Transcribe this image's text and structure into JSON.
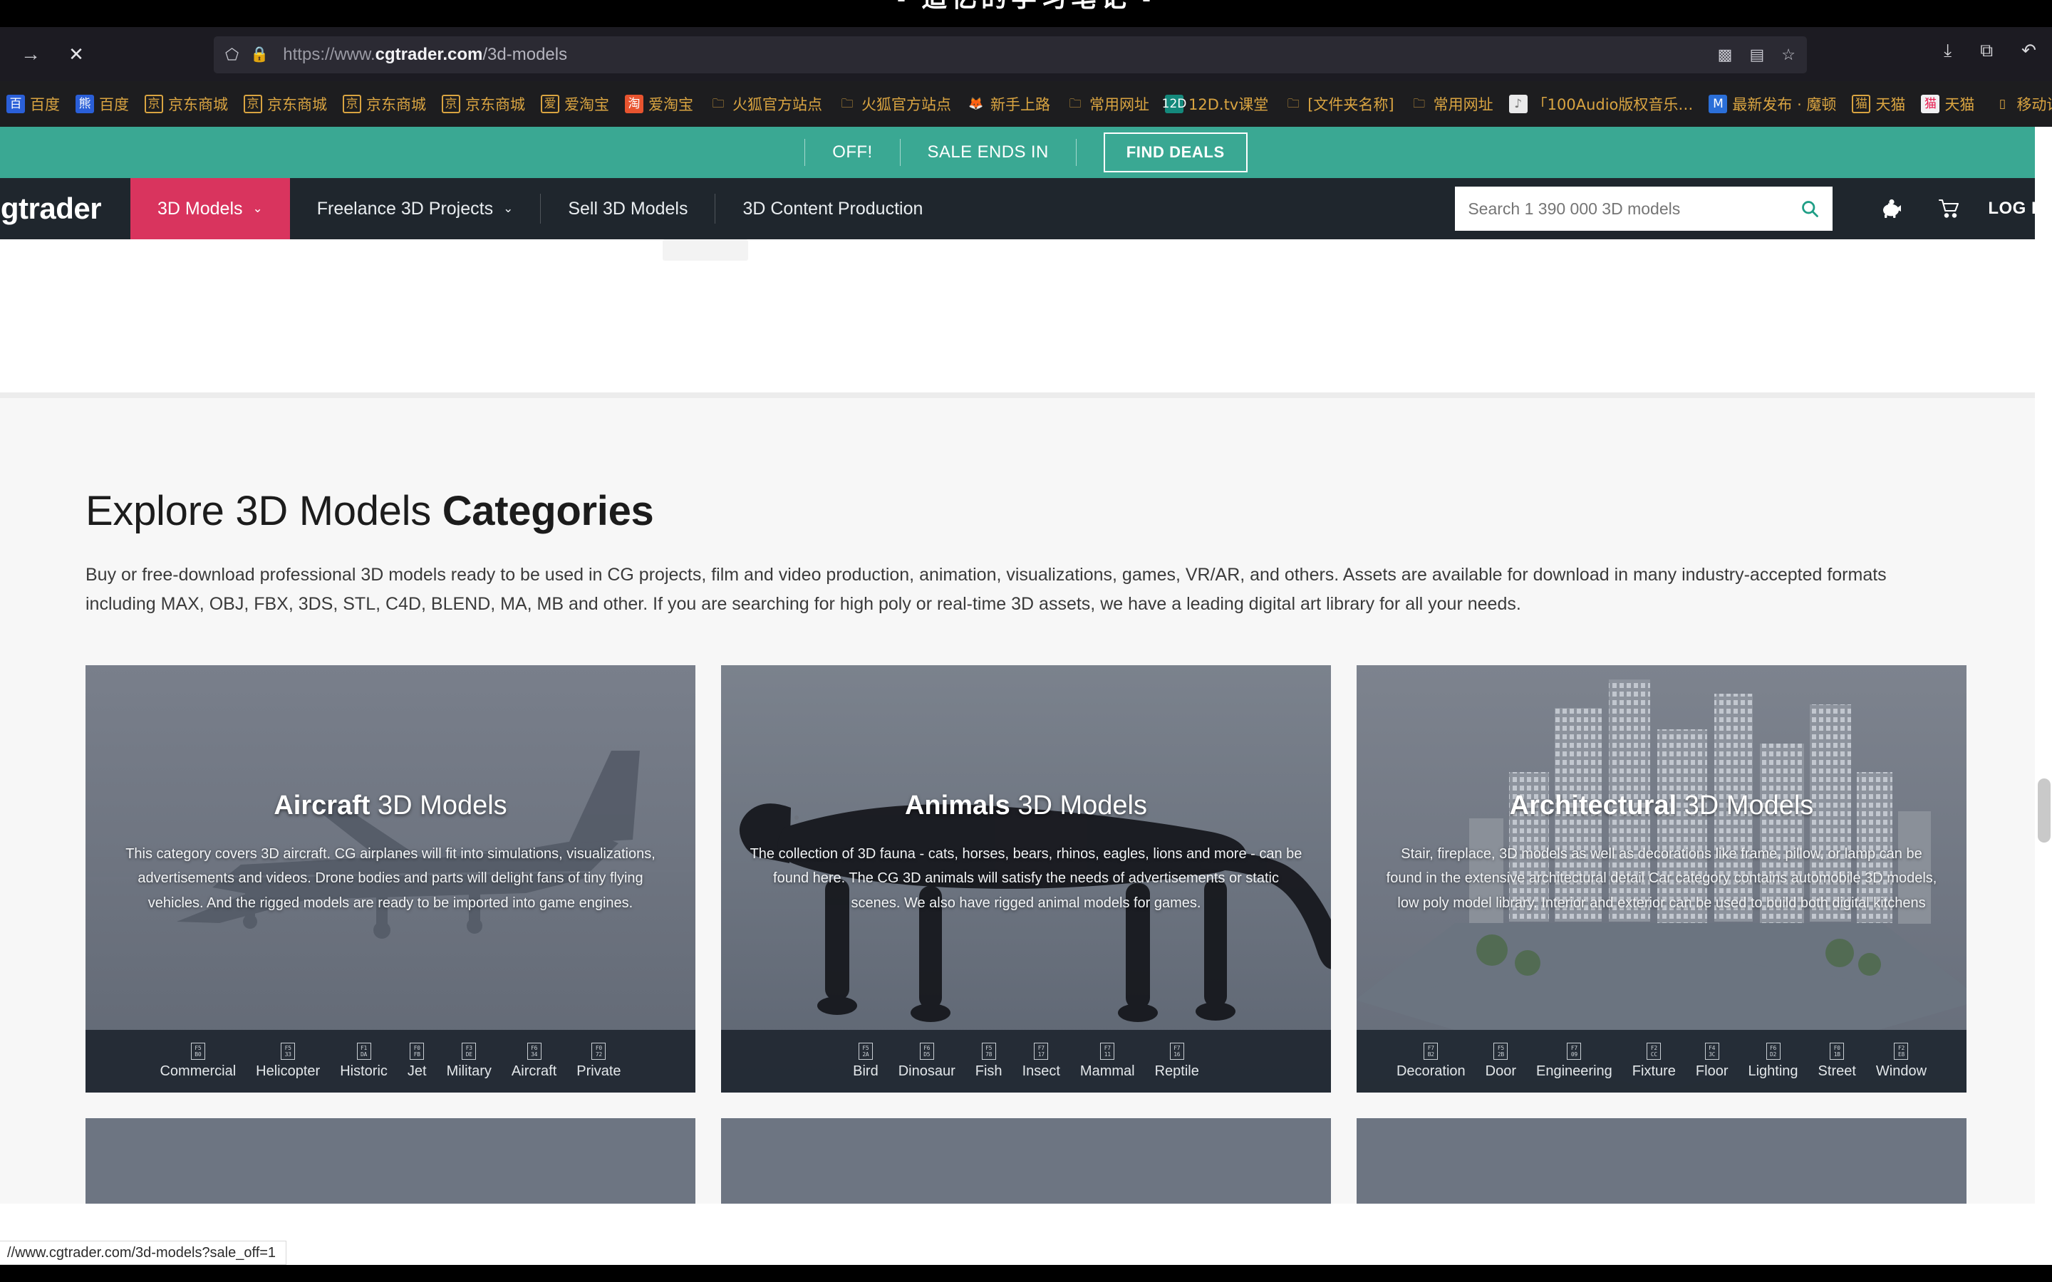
{
  "desktop": {
    "title": "- 追忆的学习笔记 -"
  },
  "browser": {
    "url_scheme": "https://www.",
    "url_host": "cgtrader.com",
    "url_path": "/3d-models",
    "icons": {
      "forward": "forward-arrow-icon",
      "stop": "stop-icon",
      "shield": "shield-icon",
      "lock": "lock-icon",
      "reader": "reader-view-icon",
      "bookmark": "bookmark-star-icon",
      "extension": "extension-icon",
      "download": "download-icon",
      "account": "account-icon",
      "overflow": "overflow-menu-icon"
    },
    "bookmarks": [
      {
        "label": "百度",
        "favicon": "fv-baidu",
        "glyph": "百"
      },
      {
        "label": "百度",
        "favicon": "fv-baidu",
        "glyph": "熊"
      },
      {
        "label": "京东商城",
        "favicon": "fv-jd",
        "glyph": "京"
      },
      {
        "label": "京东商城",
        "favicon": "fv-jd",
        "glyph": "京"
      },
      {
        "label": "京东商城",
        "favicon": "fv-jd",
        "glyph": "京"
      },
      {
        "label": "京东商城",
        "favicon": "fv-jd",
        "glyph": "京"
      },
      {
        "label": "爱淘宝",
        "favicon": "fv-jd",
        "glyph": "爱"
      },
      {
        "label": "爱淘宝",
        "favicon": "fv-tao",
        "glyph": "淘"
      },
      {
        "label": "火狐官方站点",
        "favicon": "fv-folder",
        "glyph": "🗀"
      },
      {
        "label": "火狐官方站点",
        "favicon": "fv-folder",
        "glyph": "🗀"
      },
      {
        "label": "新手上路",
        "favicon": "fv-fox",
        "glyph": "🦊"
      },
      {
        "label": "常用网址",
        "favicon": "fv-folder",
        "glyph": "🗀"
      },
      {
        "label": "12D.tv课堂",
        "favicon": "fv-12d",
        "glyph": "12D"
      },
      {
        "label": "[文件夹名称]",
        "favicon": "fv-folder",
        "glyph": "🗀"
      },
      {
        "label": "常用网址",
        "favicon": "fv-folder",
        "glyph": "🗀"
      },
      {
        "label": "「100Audio版权音乐…",
        "favicon": "fv-img",
        "glyph": "♪"
      },
      {
        "label": "最新发布 · 魔顿",
        "favicon": "fv-blue",
        "glyph": "M"
      },
      {
        "label": "天猫",
        "favicon": "fv-jd",
        "glyph": "猫"
      },
      {
        "label": "天猫",
        "favicon": "fv-tmall",
        "glyph": "猫"
      }
    ],
    "bookmarks_right": {
      "label": "移动设备上的…",
      "favicon": "fv-mobile",
      "glyph": "▯"
    },
    "status_tip": "//www.cgtrader.com/3d-models?sale_off=1"
  },
  "promo": {
    "item1": "OFF!",
    "item2": "SALE ENDS IN",
    "button": "FIND DEALS",
    "bg_color": "#3aa893"
  },
  "nav": {
    "logo": "cgtrader",
    "items": [
      {
        "label": "3D Models",
        "caret": "⌄",
        "active": true
      },
      {
        "label": "Freelance 3D Projects",
        "caret": "⌄",
        "active": false
      },
      {
        "label": "Sell 3D Models",
        "caret": "",
        "active": false
      },
      {
        "label": "3D Content Production",
        "caret": "",
        "active": false
      }
    ],
    "search_placeholder": "Search 1 390 000 3D models",
    "search_value": "",
    "login": "LOG IN",
    "accent_color": "#d9345e",
    "bg_color": "#1f262d"
  },
  "main": {
    "heading_light": "Explore 3D Models ",
    "heading_bold": "Categories",
    "lead": "Buy or free-download professional 3D models ready to be used in CG projects, film and video production, animation, visualizations, games, VR/AR, and others. Assets are available for download in many industry-accepted formats including MAX, OBJ, FBX, 3DS, STL, C4D, BLEND, MA, MB and other. If you are searching for high poly or real-time 3D assets, we have a leading digital art library for all your needs.",
    "cards": [
      {
        "title_bold": "Aircraft",
        "title_light": " 3D Models",
        "description": "This category covers 3D aircraft. CG airplanes will fit into simulations, visualizations, advertisements and videos. Drone bodies and parts will delight fans of tiny flying vehicles. And the rigged models are ready to be imported into game engines.",
        "art": "jet-fighter",
        "subcategories": [
          {
            "label": "Commercial",
            "code_top": "F5",
            "code_bot": "B0"
          },
          {
            "label": "Helicopter",
            "code_top": "F5",
            "code_bot": "33"
          },
          {
            "label": "Historic",
            "code_top": "F1",
            "code_bot": "DA"
          },
          {
            "label": "Jet",
            "code_top": "F0",
            "code_bot": "FB"
          },
          {
            "label": "Military",
            "code_top": "F3",
            "code_bot": "DE"
          },
          {
            "label": "Aircraft",
            "code_top": "F6",
            "code_bot": "34"
          },
          {
            "label": "Private",
            "code_top": "F0",
            "code_bot": "72"
          }
        ]
      },
      {
        "title_bold": "Animals",
        "title_light": " 3D Models",
        "description": "The collection of 3D fauna - cats, horses, bears, rhinos, eagles, lions and more - can be found here. The CG 3D animals will satisfy the needs of advertisements or static scenes. We also have rigged animal models for games.",
        "art": "black-panther",
        "subcategories": [
          {
            "label": "Bird",
            "code_top": "F5",
            "code_bot": "2A"
          },
          {
            "label": "Dinosaur",
            "code_top": "F6",
            "code_bot": "D5"
          },
          {
            "label": "Fish",
            "code_top": "F5",
            "code_bot": "78"
          },
          {
            "label": "Insect",
            "code_top": "F7",
            "code_bot": "17"
          },
          {
            "label": "Mammal",
            "code_top": "F7",
            "code_bot": "11"
          },
          {
            "label": "Reptile",
            "code_top": "F7",
            "code_bot": "16"
          }
        ]
      },
      {
        "title_bold": "Architectural",
        "title_light": " 3D Models",
        "description": "Stair, fireplace, 3D models as well as decorations like frame, pillow, or lamp can be found in the extensive architectural detail Car category contains automobile 3D models, low poly model library. Interior and exterior can be used to build both digital kitchens",
        "art": "city-skyline",
        "subcategories": [
          {
            "label": "Decoration",
            "code_top": "F7",
            "code_bot": "B2"
          },
          {
            "label": "Door",
            "code_top": "F5",
            "code_bot": "2B"
          },
          {
            "label": "Engineering",
            "code_top": "F7",
            "code_bot": "09"
          },
          {
            "label": "Fixture",
            "code_top": "F2",
            "code_bot": "CC"
          },
          {
            "label": "Floor",
            "code_top": "F4",
            "code_bot": "3C"
          },
          {
            "label": "Lighting",
            "code_top": "F6",
            "code_bot": "D2"
          },
          {
            "label": "Street",
            "code_top": "F0",
            "code_bot": "1B"
          },
          {
            "label": "Window",
            "code_top": "F2",
            "code_bot": "E8"
          }
        ]
      }
    ]
  }
}
